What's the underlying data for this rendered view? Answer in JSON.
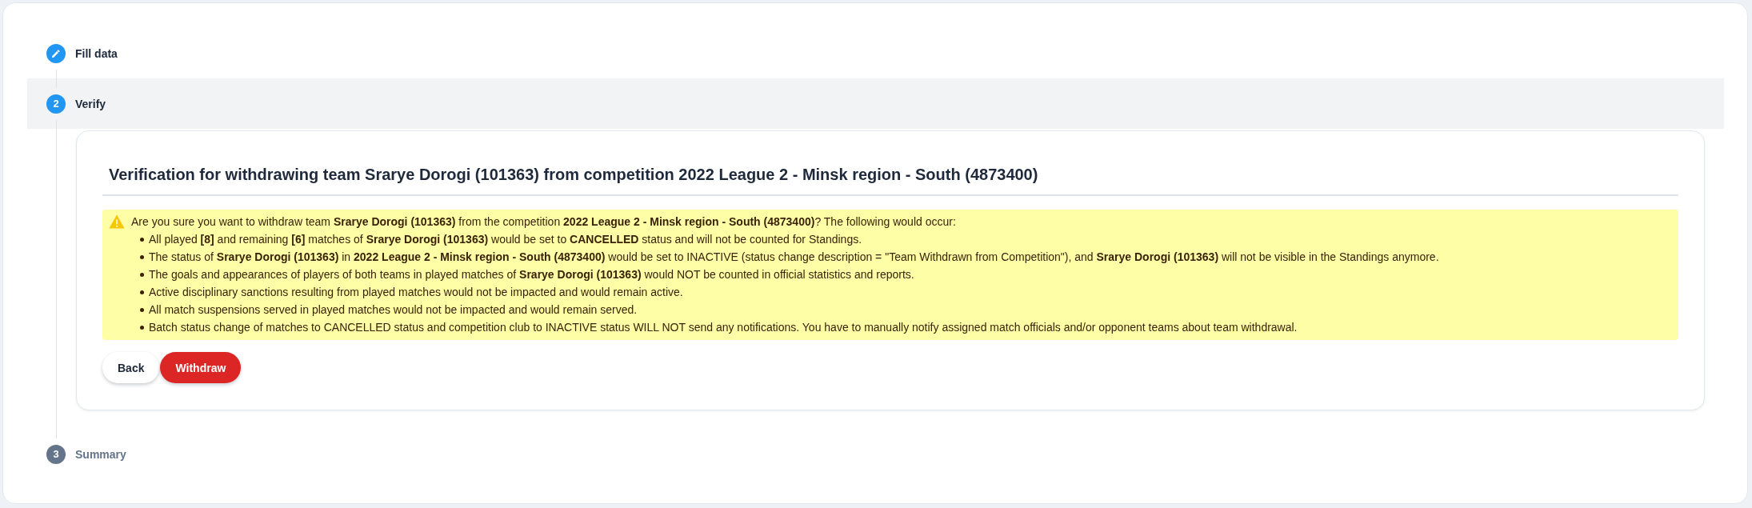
{
  "stepper": {
    "steps": [
      {
        "label": "Fill data",
        "completed": true,
        "selected": false
      },
      {
        "label": "Verify",
        "number": "2",
        "completed": false,
        "selected": true,
        "content": {
          "title": "Verification for withdrawing team Srarye Dorogi (101363) from competition 2022 League 2 - Minsk region - South (4873400)",
          "warning": {
            "intro": "Are you sure you want to withdraw team **Srarye Dorogi (101363)** from the competition **2022 League 2 - Minsk region - South (4873400)**? The following would occur:",
            "items": [
              "All played **[8]** and remaining **[6]** matches of **Srarye Dorogi (101363)** would be set to **CANCELLED** status and will not be counted for Standings.",
              "The status of **Srarye Dorogi (101363)** in **2022 League 2 - Minsk region - South (4873400)** would be set to INACTIVE (status change description = \"Team Withdrawn from Competition\"), and **Srarye Dorogi (101363)** will not be visible in the Standings anymore.",
              "The goals and appearances of players of both teams in played matches of **Srarye Dorogi (101363)** would NOT be counted in official statistics and reports.",
              "Active disciplinary sanctions resulting from played matches would not be impacted and would remain active.",
              "All match suspensions served in played matches would not be impacted and would remain served.",
              "Batch status change of matches to CANCELLED status and competition club to INACTIVE status WILL NOT send any notifications. You have to manually notify assigned match officials and/or opponent teams about team withdrawal."
            ]
          },
          "buttons": [
            {
              "label": "Back",
              "kind": "secondary"
            },
            {
              "label": "Withdraw",
              "kind": "danger"
            }
          ]
        }
      },
      {
        "label": "Summary",
        "number": "3",
        "completed": false,
        "selected": false
      }
    ]
  }
}
